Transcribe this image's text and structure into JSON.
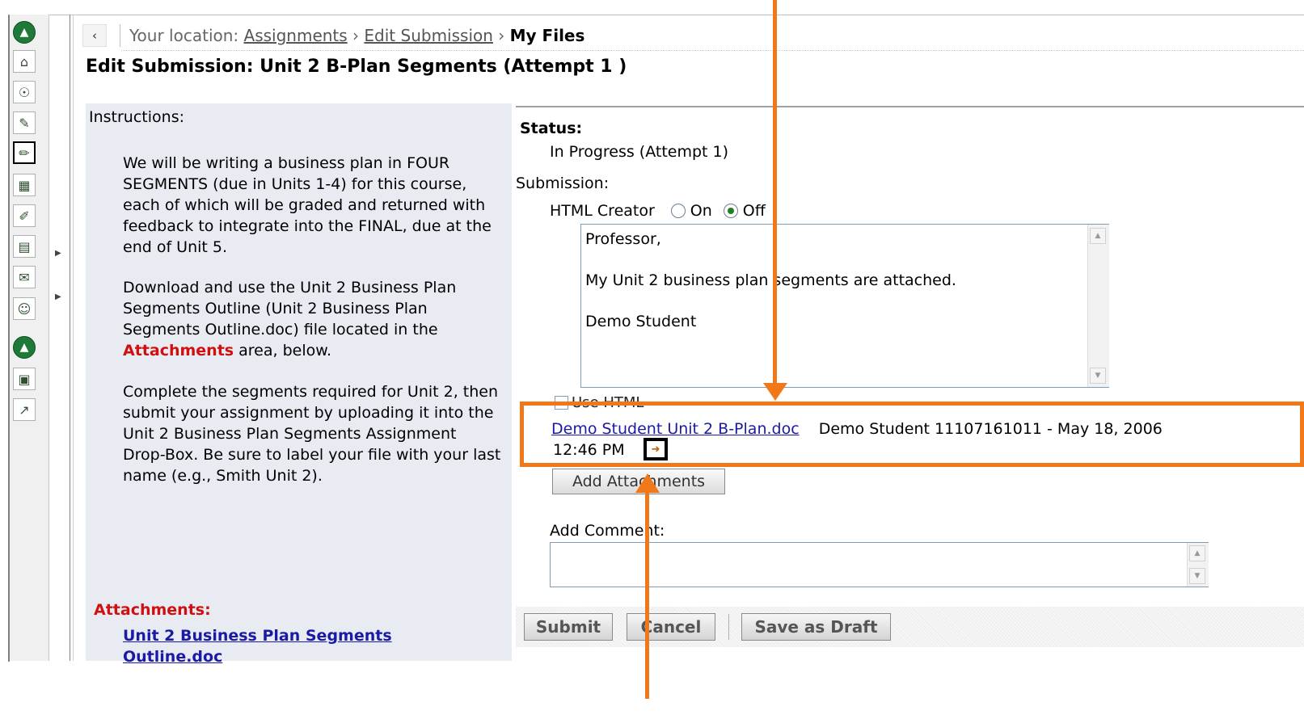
{
  "breadcrumb": {
    "back_icon": "‹",
    "prefix": "Your location: ",
    "items": [
      "Assignments",
      "Edit Submission"
    ],
    "separator": " › ",
    "current": "My Files"
  },
  "page_title": "Edit Submission: Unit 2 B-Plan Segments (Attempt 1 )",
  "instructions": {
    "heading": "Instructions:",
    "para1": "We will be writing a business plan in FOUR SEGMENTS (due in Units 1-4) for this course, each of which will be graded and returned with feedback to integrate into the FINAL, due at the end of Unit 5.",
    "para2_before": "Download and use the Unit 2 Business Plan Segments Outline (Unit 2 Business Plan Segments Outline.doc) file located in the ",
    "para2_highlight": "Attachments",
    "para2_after": " area, below.",
    "para3": "Complete the segments required for Unit 2, then submit your assignment by uploading it into the Unit 2 Business Plan Segments Assignment Drop-Box. Be sure to label your file with your last name (e.g., Smith Unit 2)."
  },
  "attachments": {
    "heading": "Attachments:",
    "link": "Unit 2 Business Plan Segments Outline.doc"
  },
  "status": {
    "label": "Status:",
    "value": "In Progress (Attempt 1)"
  },
  "submission": {
    "label": "Submission:",
    "html_creator_label": "HTML Creator",
    "on_label": "On",
    "off_label": "Off",
    "selected": "Off",
    "editor_lines": [
      "Professor,",
      "My Unit 2 business plan segments are attached.",
      "Demo Student"
    ],
    "use_html_label": "Use HTML"
  },
  "file": {
    "link": "Demo Student Unit 2 B-Plan.doc",
    "meta": "Demo Student 11107161011  -  May 18, 2006",
    "time": "12:46 PM",
    "icon": "remove-file-icon"
  },
  "add_attachments_label": "Add Attachments",
  "comment": {
    "label": "Add Comment:",
    "value": ""
  },
  "buttons": {
    "submit": "Submit",
    "cancel": "Cancel",
    "save_draft": "Save as Draft"
  },
  "toolbar_icons": [
    "collapse-icon",
    "home-icon",
    "announcements-icon",
    "course-icon",
    "assignments-icon",
    "calendar-icon",
    "bookmarks-icon",
    "documents-icon",
    "mail-icon",
    "roster-icon",
    "collapse-icon",
    "grades-icon",
    "reports-icon"
  ],
  "colors": {
    "annotation_orange": "#f07818",
    "panel_bg": "#e8ecf2",
    "attachments_red": "#d01010",
    "link_blue": "#1a1aa6"
  }
}
